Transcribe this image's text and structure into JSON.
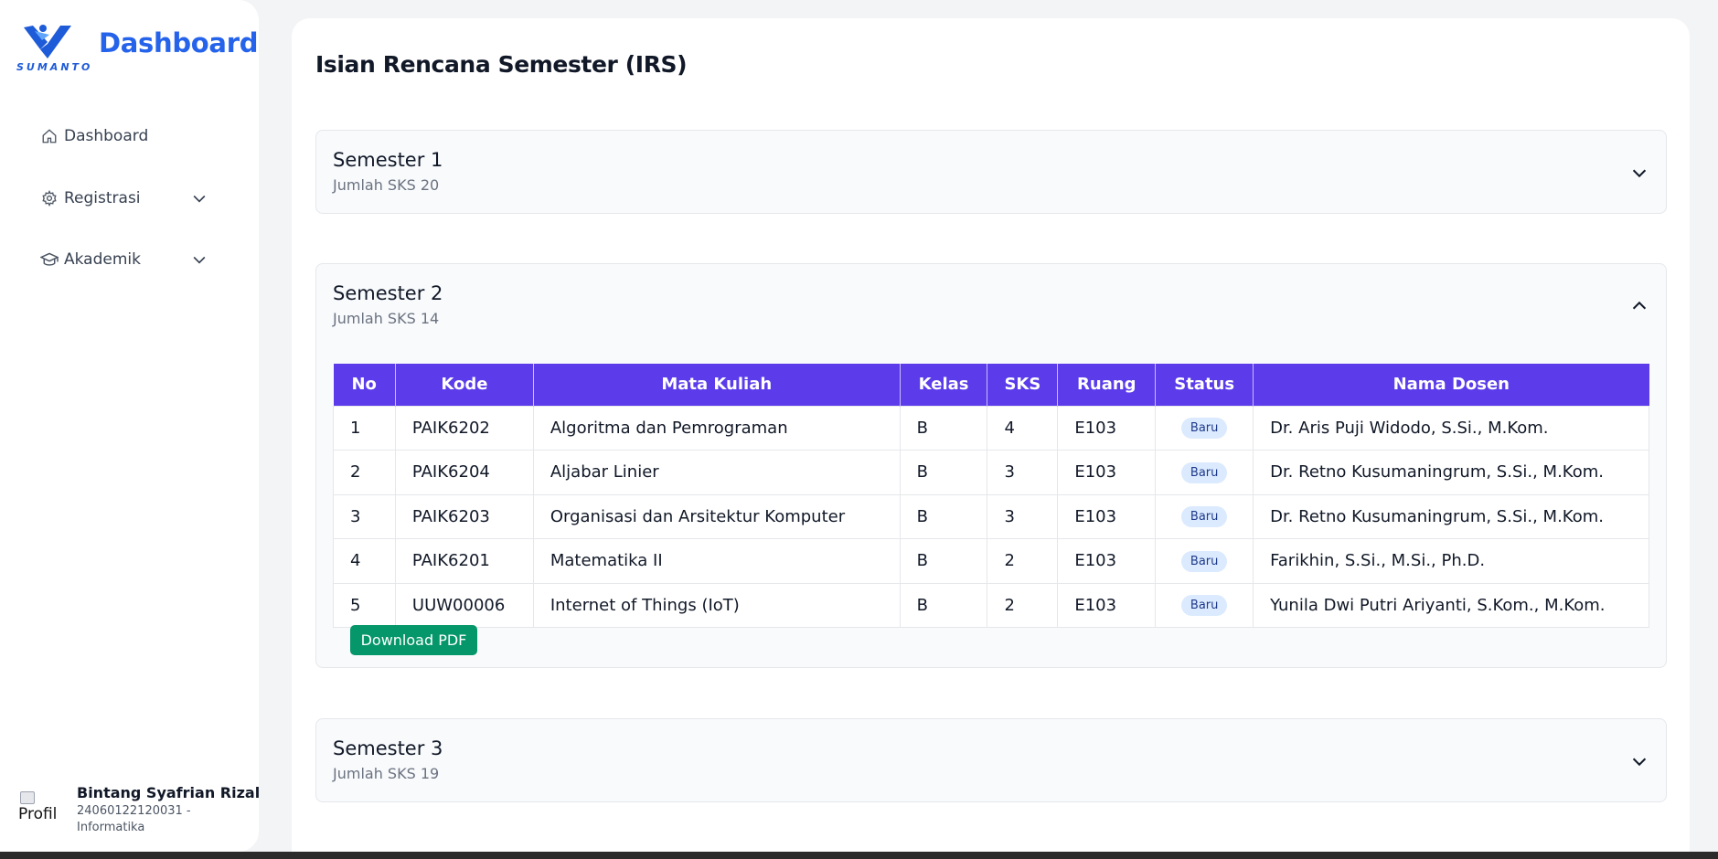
{
  "brand": {
    "title": "Dashboard",
    "logo_text": "SUMANTO",
    "accent": "#2563eb"
  },
  "sidebar": {
    "items": [
      {
        "label": "Dashboard",
        "icon": "home-icon"
      },
      {
        "label": "Registrasi",
        "icon": "gear-icon",
        "expandable": true
      },
      {
        "label": "Akademik",
        "icon": "graduation-cap-icon",
        "expandable": true
      }
    ]
  },
  "profile": {
    "avatar_alt": "Profil",
    "name": "Bintang Syafrian Rizal",
    "nim_line": "24060122120031 -",
    "program": "Informatika"
  },
  "page": {
    "title": "Isian Rencana Semester (IRS)"
  },
  "semesters": [
    {
      "title": "Semester 1",
      "sks": "Jumlah SKS 20",
      "expanded": false
    },
    {
      "title": "Semester 2",
      "sks": "Jumlah SKS 14",
      "expanded": true
    },
    {
      "title": "Semester 3",
      "sks": "Jumlah SKS 19",
      "expanded": false
    }
  ],
  "table": {
    "headers": [
      "No",
      "Kode",
      "Mata Kuliah",
      "Kelas",
      "SKS",
      "Ruang",
      "Status",
      "Nama Dosen"
    ],
    "rows": [
      [
        "1",
        "PAIK6202",
        "Algoritma dan Pemrograman",
        "B",
        "4",
        "E103",
        "Baru",
        "Dr. Aris Puji Widodo, S.Si., M.Kom."
      ],
      [
        "2",
        "PAIK6204",
        "Aljabar Linier",
        "B",
        "3",
        "E103",
        "Baru",
        "Dr. Retno Kusumaningrum, S.Si., M.Kom."
      ],
      [
        "3",
        "PAIK6203",
        "Organisasi dan Arsitektur Komputer",
        "B",
        "3",
        "E103",
        "Baru",
        "Dr. Retno Kusumaningrum, S.Si., M.Kom."
      ],
      [
        "4",
        "PAIK6201",
        "Matematika II",
        "B",
        "2",
        "E103",
        "Baru",
        "Farikhin, S.Si., M.Si., Ph.D."
      ],
      [
        "5",
        "UUW00006",
        "Internet of Things (IoT)",
        "B",
        "2",
        "E103",
        "Baru",
        "Yunila Dwi Putri Ariyanti, S.Kom., M.Kom."
      ]
    ],
    "header_color": "#5b3bea"
  },
  "download_button": {
    "label": "Download PDF",
    "color": "#059669"
  }
}
